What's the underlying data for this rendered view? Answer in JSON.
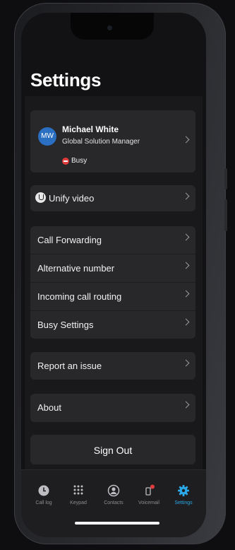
{
  "header": {
    "title": "Settings"
  },
  "profile": {
    "initials": "MW",
    "name": "Michael White",
    "role": "Global Solution Manager",
    "status": "Busy",
    "status_color": "#e03c3c",
    "avatar_color": "#2a6fc1"
  },
  "unify": {
    "label": "Unify video"
  },
  "call_settings": [
    {
      "label": "Call Forwarding"
    },
    {
      "label": "Alternative number"
    },
    {
      "label": "Incoming call routing"
    },
    {
      "label": "Busy Settings"
    }
  ],
  "report": {
    "label": "Report an issue"
  },
  "about": {
    "label": "About"
  },
  "signout": {
    "label": "Sign Out"
  },
  "tabs": [
    {
      "label": "Call log",
      "icon": "clock-icon"
    },
    {
      "label": "Keypad",
      "icon": "keypad-icon"
    },
    {
      "label": "Contacts",
      "icon": "contacts-icon"
    },
    {
      "label": "Voicemail",
      "icon": "voicemail-icon",
      "badge": true
    },
    {
      "label": "Settings",
      "icon": "gear-icon",
      "active": true
    }
  ],
  "accent_color": "#2aa8e8"
}
